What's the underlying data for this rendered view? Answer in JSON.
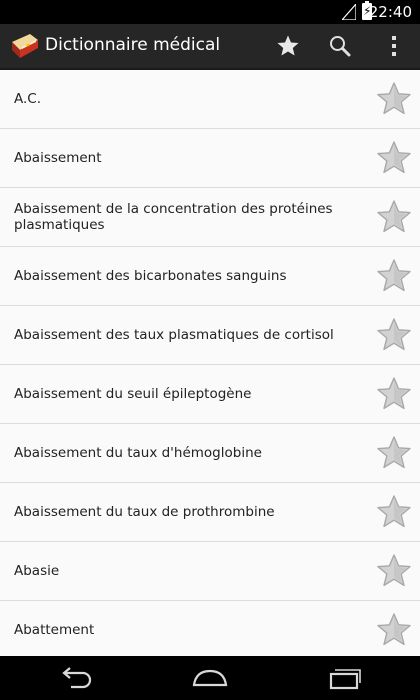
{
  "status_bar": {
    "time": "22:40"
  },
  "action_bar": {
    "title": "Dictionnaire médical",
    "favorites_icon": "star-icon",
    "search_icon": "search-icon",
    "menu_icon": "overflow-menu-icon"
  },
  "entries": [
    {
      "label": "A.C."
    },
    {
      "label": "Abaissement"
    },
    {
      "label": "Abaissement de la concentration des protéines plasmatiques"
    },
    {
      "label": "Abaissement des bicarbonates sanguins"
    },
    {
      "label": "Abaissement des taux plasmatiques de cortisol"
    },
    {
      "label": "Abaissement du seuil épileptogène"
    },
    {
      "label": "Abaissement du taux d'hémoglobine"
    },
    {
      "label": "Abaissement du taux de prothrombine"
    },
    {
      "label": "Abasie"
    },
    {
      "label": "Abattement"
    }
  ],
  "nav_bar": {
    "back_icon": "back-icon",
    "home_icon": "home-icon",
    "recents_icon": "recents-icon"
  },
  "colors": {
    "action_bar": "#262626",
    "list_background": "#fafafa",
    "star_fill": "#cfcfcf"
  }
}
